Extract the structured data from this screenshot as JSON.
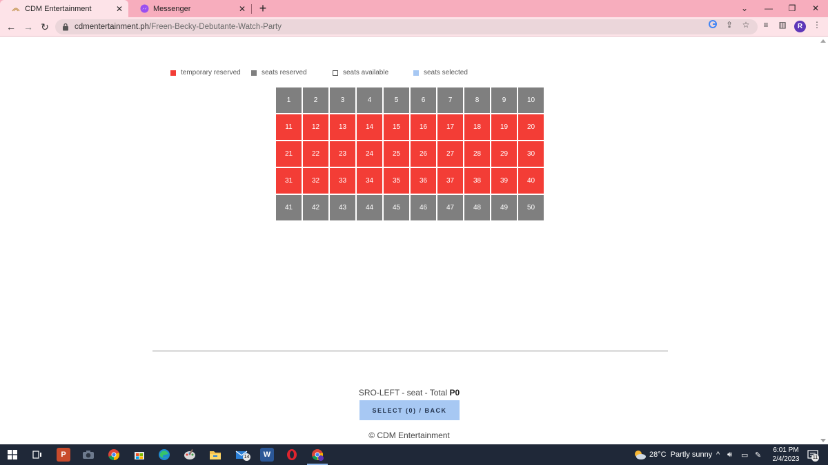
{
  "browser": {
    "tabs": [
      {
        "title": "CDM Entertainment",
        "active": true
      },
      {
        "title": "Messenger",
        "active": false
      }
    ],
    "url_host": "cdmentertainment.ph",
    "url_path": "/Freen-Becky-Debutante-Watch-Party",
    "profile_initial": "R"
  },
  "legend": [
    {
      "label": "temporary reserved",
      "color": "#f33d36"
    },
    {
      "label": "seats reserved",
      "color": "#7f7f7f"
    },
    {
      "label": "seats available",
      "color": "#ffffff"
    },
    {
      "label": "seats selected",
      "color": "#a7c8f3"
    }
  ],
  "colors": {
    "temporary_reserved": "#f33d36",
    "reserved": "#7f7f7f",
    "selected": "#a7c8f3",
    "tabstrip": "#f7adbd",
    "taskbar": "#1f2838"
  },
  "seats": {
    "columns": 10,
    "rows": [
      {
        "status": "reserved",
        "numbers": [
          "1",
          "2",
          "3",
          "4",
          "5",
          "6",
          "7",
          "8",
          "9",
          "10"
        ]
      },
      {
        "status": "temporary_reserved",
        "numbers": [
          "11",
          "12",
          "13",
          "14",
          "15",
          "16",
          "17",
          "18",
          "19",
          "20"
        ]
      },
      {
        "status": "temporary_reserved",
        "numbers": [
          "21",
          "22",
          "23",
          "24",
          "25",
          "26",
          "27",
          "28",
          "29",
          "30"
        ]
      },
      {
        "status": "temporary_reserved",
        "numbers": [
          "31",
          "32",
          "33",
          "34",
          "35",
          "36",
          "37",
          "38",
          "39",
          "40"
        ]
      },
      {
        "status": "reserved",
        "numbers": [
          "41",
          "42",
          "43",
          "44",
          "45",
          "46",
          "47",
          "48",
          "49",
          "50"
        ]
      }
    ]
  },
  "summary": {
    "text": "SRO-LEFT - seat - Total ",
    "total": "P0"
  },
  "select_button": "SELECT (0) / BACK",
  "copyright": "© CDM Entertainment",
  "taskbar": {
    "apps": [
      "start-icon",
      "task-view-icon",
      "powerpoint-icon",
      "camera-icon",
      "chrome-icon",
      "store-icon",
      "edge-icon",
      "paint-icon",
      "file-explorer-icon",
      "mail-icon",
      "word-icon",
      "opera-icon",
      "chrome-profile-icon"
    ],
    "mail_badge": "14",
    "weather_temp": "28°C",
    "weather_desc": "Partly sunny",
    "time": "6:01 PM",
    "date": "2/4/2023",
    "notification_count": "11"
  }
}
